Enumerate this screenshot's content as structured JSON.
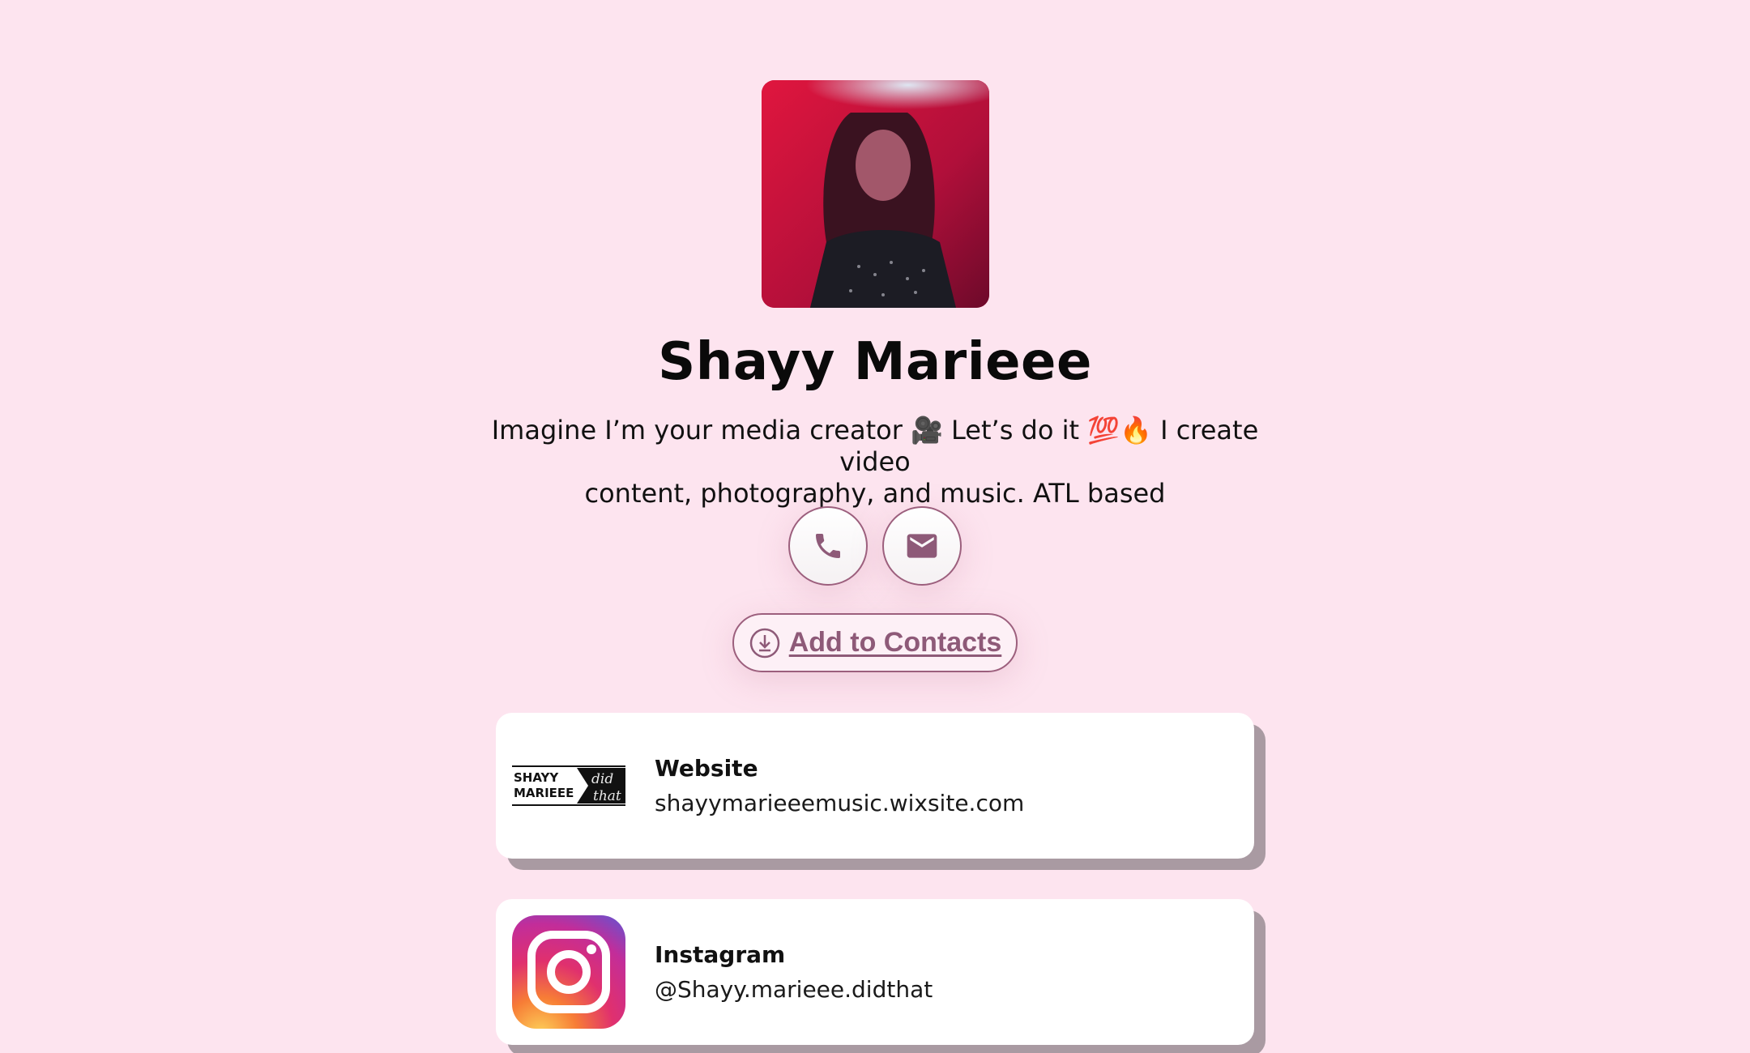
{
  "profile": {
    "name": "Shayy Marieee",
    "bio_line1": "Imagine I’m your media creator 🎥 Let’s do it 💯🔥 I create video",
    "bio_line2": "content, photography, and music. ATL based"
  },
  "actions": {
    "phone_icon": "phone-icon",
    "mail_icon": "mail-icon",
    "add_contacts_label": "Add to Contacts"
  },
  "links": [
    {
      "title": "Website",
      "subtitle": "shayymarieeemusic.wixsite.com",
      "logo_text_1": "SHAYY",
      "logo_text_2": "MARIEEE",
      "logo_script_1": "did",
      "logo_script_2": "that"
    },
    {
      "title": "Instagram",
      "subtitle": "@Shayy.marieee.didthat",
      "icon": "instagram-icon"
    }
  ],
  "colors": {
    "background": "#fde4ef",
    "accent": "#9c5f7d",
    "card_shadow": "#a99aa2"
  }
}
